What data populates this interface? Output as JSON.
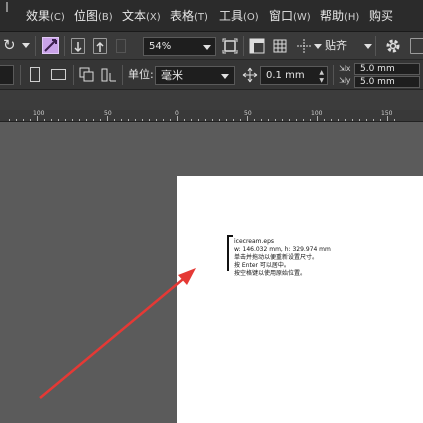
{
  "menubar": {
    "items": [
      {
        "label": "效果",
        "hotkey": "(C)"
      },
      {
        "label": "位图",
        "hotkey": "(B)"
      },
      {
        "label": "文本",
        "hotkey": "(X)"
      },
      {
        "label": "表格",
        "hotkey": "(T)"
      },
      {
        "label": "工具",
        "hotkey": "(O)"
      },
      {
        "label": "窗口",
        "hotkey": "(W)"
      },
      {
        "label": "帮助",
        "hotkey": "(H)"
      },
      {
        "label": "购买",
        "hotkey": ""
      }
    ]
  },
  "toolbar1": {
    "zoom_value": "54%",
    "snap_label": "贴齐"
  },
  "toolbar2": {
    "units_label": "单位:",
    "units_value": "毫米",
    "nudge_value": "0.1 mm",
    "dup_x": "5.0 mm",
    "dup_y": "5.0 mm"
  },
  "ruler": {
    "labels": [
      "100",
      "50",
      "0",
      "50",
      "100",
      "150"
    ]
  },
  "canvas": {
    "info_lines": [
      "icecream.eps",
      "w: 146.032 mm, h: 329.974 mm",
      "单击并拖动以便重新设置尺寸。",
      "按 Enter 可以居中。",
      "按空格键以使用原始位置。"
    ]
  },
  "colors": {
    "menubar_bg": "#2b2b2b",
    "toolbar_bg": "#3a3a3a",
    "canvas_bg": "#5b5b5b",
    "page_bg": "#ffffff",
    "arrow": "#e53935",
    "active_tool": "#c9a2e8"
  }
}
